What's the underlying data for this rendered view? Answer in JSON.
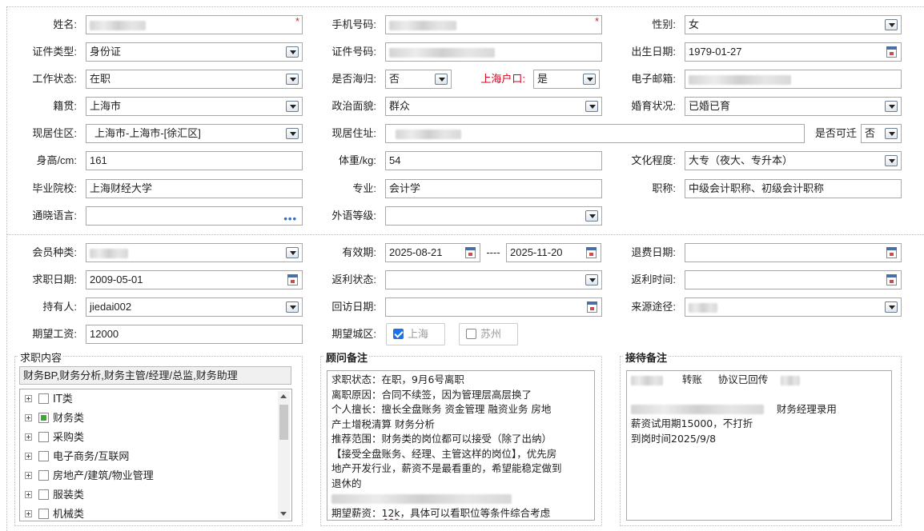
{
  "form": {
    "name": {
      "label": "姓名:",
      "value": ""
    },
    "phone": {
      "label": "手机号码:",
      "value": ""
    },
    "gender": {
      "label": "性别:",
      "value": "女"
    },
    "id_type": {
      "label": "证件类型:",
      "value": "身份证"
    },
    "id_no": {
      "label": "证件号码:",
      "value": ""
    },
    "birth": {
      "label": "出生日期:",
      "value": "1979-01-27"
    },
    "work_status": {
      "label": "工作状态:",
      "value": "在职"
    },
    "returnee": {
      "label": "是否海归:",
      "value": "否"
    },
    "sh_hukou": {
      "label": "上海户口:",
      "value": "是"
    },
    "email": {
      "label": "电子邮箱:",
      "value": ""
    },
    "native": {
      "label": "籍贯:",
      "value": "上海市"
    },
    "political": {
      "label": "政治面貌:",
      "value": "群众"
    },
    "marital": {
      "label": "婚育状况:",
      "value": "已婚已育"
    },
    "residence_area": {
      "label": "现居住区:",
      "value": "上海市-上海市-[徐汇区]"
    },
    "address": {
      "label": "现居住址:",
      "value": ""
    },
    "relocate": {
      "label": "是否可迁",
      "value": "否"
    },
    "height": {
      "label": "身高/cm:",
      "value": "161"
    },
    "weight": {
      "label": "体重/kg:",
      "value": "54"
    },
    "education": {
      "label": "文化程度:",
      "value": "大专（夜大、专升本）"
    },
    "school": {
      "label": "毕业院校:",
      "value": "上海财经大学"
    },
    "major": {
      "label": "专业:",
      "value": "会计学"
    },
    "title": {
      "label": "职称:",
      "value": "中级会计职称、初级会计职称"
    },
    "languages": {
      "label": "通晓语言:",
      "value": ""
    },
    "foreign_level": {
      "label": "外语等级:",
      "value": ""
    }
  },
  "member": {
    "type": {
      "label": "会员种类:",
      "value": ""
    },
    "validity": {
      "label": "有效期:",
      "from": "2025-08-21",
      "dash": "----",
      "to": "2025-11-20"
    },
    "refund_date": {
      "label": "退费日期:",
      "value": ""
    },
    "job_date": {
      "label": "求职日期:",
      "value": "2009-05-01"
    },
    "rebate_status": {
      "label": "返利状态:",
      "value": ""
    },
    "rebate_time": {
      "label": "返利时间:",
      "value": ""
    },
    "holder": {
      "label": "持有人:",
      "value": "jiedai002"
    },
    "visit_date": {
      "label": "回访日期:",
      "value": ""
    },
    "source": {
      "label": "来源途径:",
      "value": ""
    },
    "salary": {
      "label": "期望工资:",
      "value": "12000"
    },
    "city": {
      "label": "期望城区:",
      "options": [
        "上海",
        "苏州"
      ],
      "checked": [
        true,
        false
      ]
    }
  },
  "job_panel": {
    "title": "求职内容",
    "summary": "财务BP,财务分析,财务主管/经理/总监,财务助理",
    "tree": [
      "IT类",
      "财务类",
      "采购类",
      "电子商务/互联网",
      "房地产/建筑/物业管理",
      "服装类",
      "机械类"
    ],
    "tree_checked": [
      false,
      true,
      false,
      false,
      false,
      false,
      false
    ]
  },
  "advisor_panel": {
    "title": "顾问备注",
    "lines": [
      "求职状态：在职，9月6号离职",
      "离职原因：合同不续签，因为管理层高层换了",
      "个人擅长：擅长全盘账务 资金管理 融资业务 房地",
      "产土增税清算 财务分析",
      "推荐范围：财务类的岗位都可以接受（除了出纳）",
      "【接受全盘账务、经理、主管这样的岗位】，优先房",
      "地产开发行业，薪资不是最看重的，希望能稳定做到",
      "退休的"
    ],
    "expect_prefix": "期望薪资：",
    "expect_val": "12k",
    "expect_suffix": "，具体可以看职位等条件综合考虑"
  },
  "reception_panel": {
    "title": "接待备注",
    "line1_a": "转账",
    "line1_b": "协议已回传",
    "line2": "财务经理录用",
    "line3": "薪资试用期15000，不打折",
    "line4": "到岗时间2025/9/8"
  }
}
